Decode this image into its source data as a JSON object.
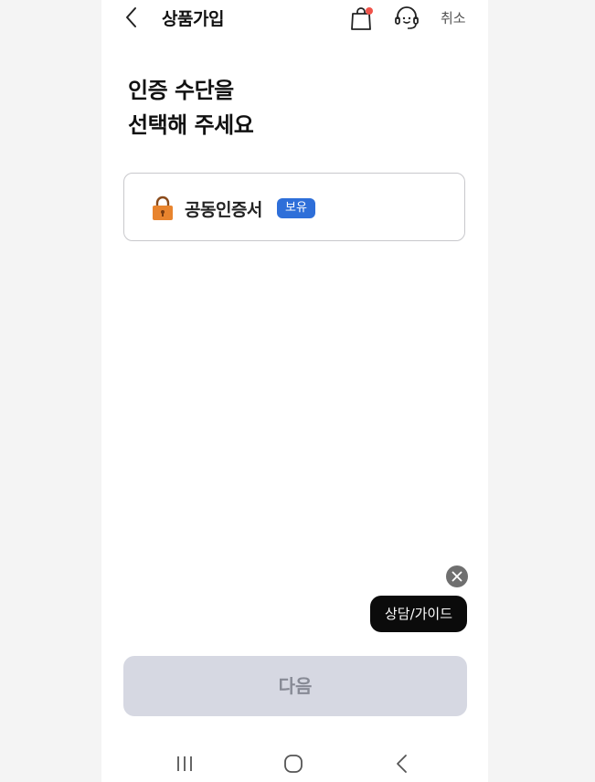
{
  "header": {
    "title": "상품가입",
    "cancel_label": "취소",
    "back_icon": "chevron-left-icon",
    "bag_icon": "shopping-bag-icon",
    "support_icon": "headset-icon",
    "notification_color": "#f0534a"
  },
  "heading": {
    "line1": "인증 수단을",
    "line2": "선택해 주세요"
  },
  "auth_methods": [
    {
      "label": "공동인증서",
      "badge": "보유",
      "icon": "lock-icon",
      "icon_color": "#e8842e",
      "badge_color": "#2e6fd9"
    }
  ],
  "floating": {
    "guide_label": "상담/가이드",
    "close_icon": "close-icon"
  },
  "footer": {
    "next_label": "다음"
  },
  "system_nav": {
    "recent_icon": "recent-apps-icon",
    "home_icon": "home-icon",
    "back_icon": "back-icon"
  }
}
